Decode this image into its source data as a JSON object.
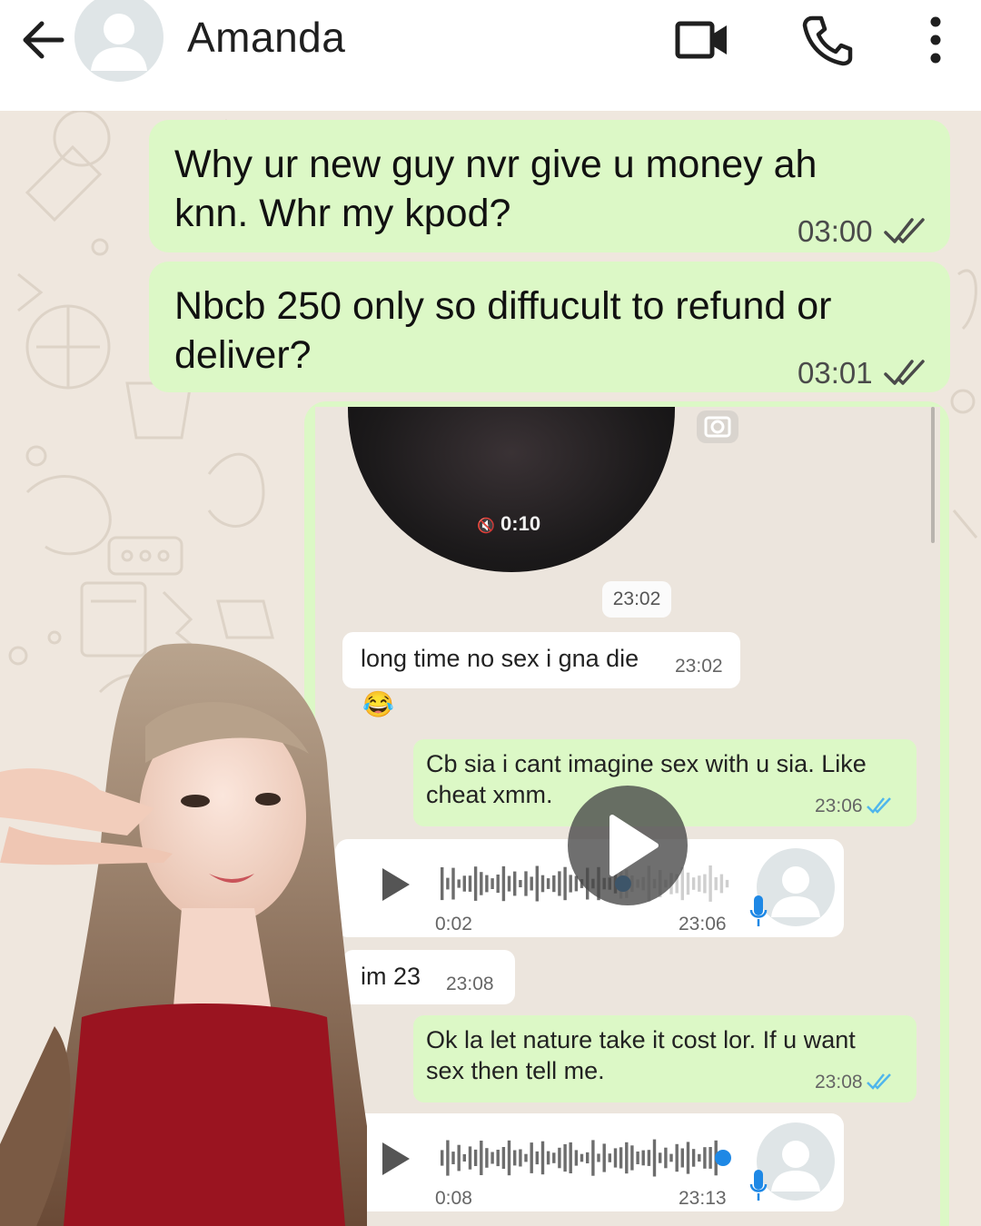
{
  "header": {
    "contact_name": "Amanda",
    "icons": [
      "back-arrow-icon",
      "avatar-icon",
      "video-call-icon",
      "phone-icon",
      "more-vert-icon"
    ]
  },
  "messages": [
    {
      "text": "Why ur new guy nvr give u money ah knn. Whr my kpod?",
      "time": "03:00",
      "status": "read"
    },
    {
      "text": "Nbcb 250 only so diffucult to refund or deliver?",
      "time": "03:01",
      "status": "read"
    }
  ],
  "embedded": {
    "video_note_duration": "0:10",
    "date_chip": "23:02",
    "incoming_1": {
      "text": "long time no sex i gna die",
      "time": "23:02",
      "emoji": "😂"
    },
    "outgoing_1": {
      "text": "Cb sia i cant imagine sex with u sia. Like cheat xmm.",
      "time": "23:06"
    },
    "voice_1": {
      "duration": "0:02",
      "time": "23:06",
      "progress": 0.62
    },
    "incoming_2": {
      "text": "im 23",
      "time": "23:08"
    },
    "outgoing_2": {
      "text": "Ok la let nature take it cost lor. If u want sex then tell me.",
      "time": "23:08"
    },
    "voice_2": {
      "duration": "0:08",
      "time": "23:13",
      "progress": 1.0
    }
  },
  "colors": {
    "outgoing_bubble": "#dcf8c6",
    "chat_background": "#efe7de",
    "tick_read": "#4fb6ec",
    "voice_progress": "#1e88e5"
  }
}
